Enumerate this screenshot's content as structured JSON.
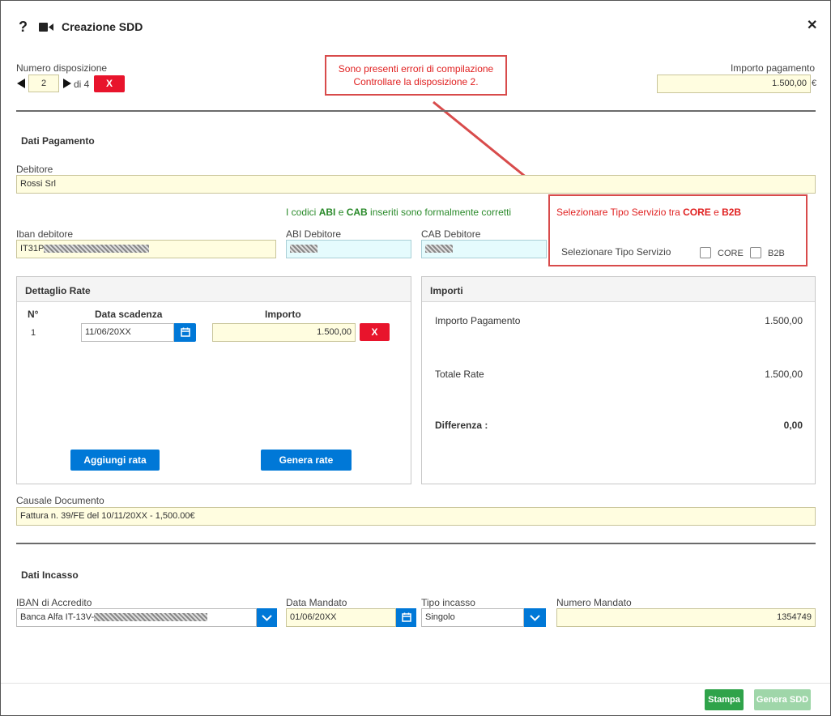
{
  "dialog": {
    "title": "Creazione SDD",
    "help_icon": "question-mark-icon",
    "video_icon": "video-camera-icon",
    "close_icon": "close-icon"
  },
  "header": {
    "numero_label": "Numero disposizione",
    "numero_value": "2",
    "numero_total": "di 4",
    "delete_label": "X",
    "importo_label": "Importo pagamento",
    "importo_value": "1.500,00",
    "currency": "€"
  },
  "error_callout": {
    "line1": "Sono presenti errori di compilazione",
    "line2": "Controllare la disposizione 2."
  },
  "dati_pagamento": {
    "title": "Dati Pagamento",
    "debitore_label": "Debitore",
    "debitore_value": "Rossi Srl",
    "codes_msg_pre": "I codici ",
    "codes_abi": "ABI",
    "codes_and": " e ",
    "codes_cab": "CAB",
    "codes_msg_post": " inseriti sono formalmente corretti",
    "iban_label": "Iban debitore",
    "iban_prefix": "IT31P",
    "abi_label": "ABI Debitore",
    "cab_label": "CAB Debitore"
  },
  "tipo_servizio": {
    "msg_pre": "Selezionare Tipo Servizio tra ",
    "msg_core": "CORE",
    "msg_and": " e ",
    "msg_b2b": "B2B",
    "label": "Selezionare Tipo Servizio",
    "core_label": "CORE",
    "b2b_label": "B2B"
  },
  "dettaglio_rate": {
    "title": "Dettaglio Rate",
    "col_n": "N°",
    "col_data": "Data scadenza",
    "col_importo": "Importo",
    "rows": [
      {
        "n": "1",
        "data": "11/06/20XX",
        "importo": "1.500,00",
        "delete": "X"
      }
    ],
    "aggiungi_label": "Aggiungi rata",
    "genera_label": "Genera rate",
    "calendar_icon": "calendar-icon"
  },
  "importi": {
    "title": "Importi",
    "pagamento_label": "Importo Pagamento",
    "pagamento_value": "1.500,00",
    "totale_label": "Totale Rate",
    "totale_value": "1.500,00",
    "differenza_label": "Differenza :",
    "differenza_value": "0,00"
  },
  "causale": {
    "label": "Causale Documento",
    "value": "Fattura n. 39/FE del 10/11/20XX - 1,500.00€"
  },
  "dati_incasso": {
    "title": "Dati Incasso",
    "iban_label": "IBAN di Accredito",
    "iban_prefix": "Banca Alfa IT-13V-",
    "data_label": "Data Mandato",
    "data_value": "01/06/20XX",
    "tipo_label": "Tipo incasso",
    "tipo_value": "Singolo",
    "numero_label": "Numero Mandato",
    "numero_value": "1354749"
  },
  "footer": {
    "stampa_label": "Stampa",
    "genera_label": "Genera SDD"
  },
  "colors": {
    "error_red": "#e02020",
    "primary_blue": "#0078d7",
    "success_green": "#2fa34a",
    "field_yellow": "#fffde0",
    "field_cyan": "#e5fbfd"
  }
}
